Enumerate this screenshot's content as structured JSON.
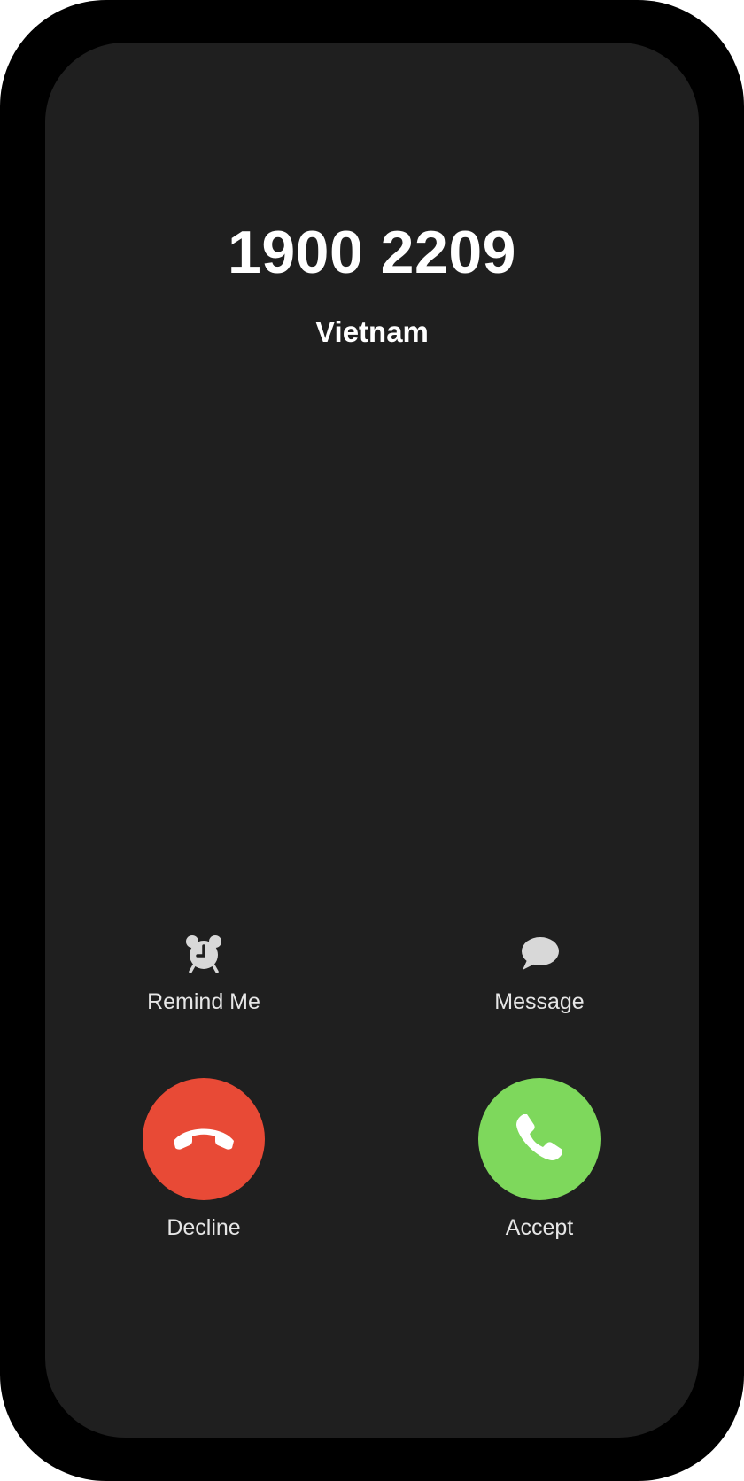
{
  "call": {
    "number": "1900 2209",
    "location": "Vietnam"
  },
  "actions": {
    "remind_label": "Remind Me",
    "message_label": "Message",
    "decline_label": "Decline",
    "accept_label": "Accept"
  },
  "icons": {
    "remind": "alarm-clock-icon",
    "message": "speech-bubble-icon",
    "decline": "phone-hangup-icon",
    "accept": "phone-icon"
  },
  "colors": {
    "decline": "#e84a36",
    "accept": "#7ed85c",
    "screen": "#1f1f1f"
  }
}
